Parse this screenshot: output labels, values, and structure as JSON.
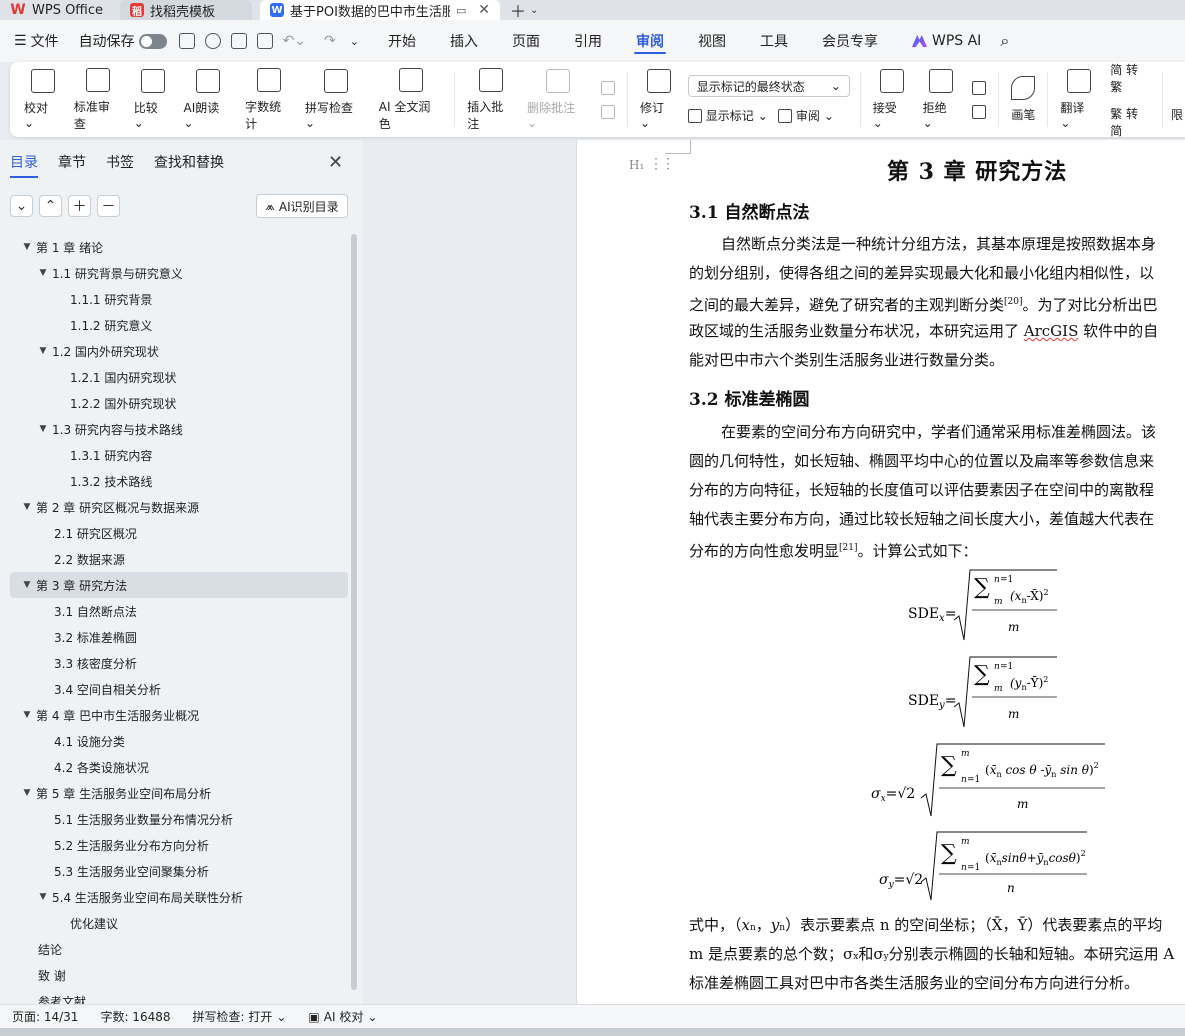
{
  "tabs": [
    {
      "label": "WPS Office",
      "icon": "wps-logo-icon"
    },
    {
      "label": "找稻壳模板",
      "icon": "daoke-icon"
    },
    {
      "label": "基于POI数据的巴中市生活服务",
      "icon": "word-doc-icon",
      "active": true
    }
  ],
  "menubar": {
    "file": "文件",
    "autosave": "自动保存",
    "tabs": [
      "开始",
      "插入",
      "页面",
      "引用",
      "审阅",
      "视图",
      "工具",
      "会员专享"
    ],
    "active_tab": "审阅",
    "wps_ai": "WPS AI"
  },
  "ribbon": {
    "proof": "校对",
    "standard_review": "标准审查",
    "compare": "比较",
    "ai_read": "AI朗读",
    "word_count": "字数统计",
    "spell_check": "拼写检查",
    "ai_polish": "AI 全文润色",
    "insert_comment": "插入批注",
    "delete_comment": "删除批注",
    "display_mode": "显示标记的最终状态",
    "track": "修订",
    "show_marks": "显示标记",
    "review": "审阅",
    "accept": "接受",
    "reject": "拒绝",
    "pen": "画笔",
    "translate": "翻译",
    "to_traditional": "简 转繁",
    "to_simplified": "繁 转简",
    "restrict": "限"
  },
  "leftpanel": {
    "tabs": [
      "目录",
      "章节",
      "书签",
      "查找和替换"
    ],
    "active_tab": "目录",
    "ai_toc": "AI识别目录",
    "toc": [
      {
        "label": "第 1 章  绪论",
        "level": 1,
        "caret": true
      },
      {
        "label": "1.1  研究背景与研究意义",
        "level": 2,
        "caret": true
      },
      {
        "label": "1.1.1  研究背景",
        "level": 3
      },
      {
        "label": "1.1.2  研究意义",
        "level": 3
      },
      {
        "label": "1.2  国内外研究现状",
        "level": 2,
        "caret": true
      },
      {
        "label": "1.2.1  国内研究现状",
        "level": 3
      },
      {
        "label": "1.2.2  国外研究现状",
        "level": 3
      },
      {
        "label": "1.3  研究内容与技术路线",
        "level": 2,
        "caret": true
      },
      {
        "label": "1.3.1  研究内容",
        "level": 3
      },
      {
        "label": "1.3.2  技术路线",
        "level": 3
      },
      {
        "label": "第 2 章  研究区概况与数据来源",
        "level": 1,
        "caret": true
      },
      {
        "label": "2.1  研究区概况",
        "level": 2
      },
      {
        "label": "2.2  数据来源",
        "level": 2
      },
      {
        "label": "第 3 章  研究方法",
        "level": 1,
        "caret": true,
        "selected": true
      },
      {
        "label": "3.1  自然断点法",
        "level": 2
      },
      {
        "label": "3.2  标准差椭圆",
        "level": 2
      },
      {
        "label": "3.3  核密度分析",
        "level": 2
      },
      {
        "label": "3.4  空间自相关分析",
        "level": 2
      },
      {
        "label": "第 4 章  巴中市生活服务业概况",
        "level": 1,
        "caret": true
      },
      {
        "label": "4.1  设施分类",
        "level": 2
      },
      {
        "label": "4.2  各类设施状况",
        "level": 2
      },
      {
        "label": "第 5 章  生活服务业空间布局分析",
        "level": 1,
        "caret": true
      },
      {
        "label": "5.1  生活服务业数量分布情况分析",
        "level": 2
      },
      {
        "label": "5.2  生活服务业分布方向分析",
        "level": 2
      },
      {
        "label": "5.3  生活服务业空间聚集分析",
        "level": 2
      },
      {
        "label": "5.4  生活服务业空间布局关联性分析",
        "level": 2,
        "caret": true
      },
      {
        "label": "优化建议",
        "level": 3
      },
      {
        "label": "结论",
        "level": 1
      },
      {
        "label": "致    谢",
        "level": 1
      },
      {
        "label": "参考文献",
        "level": 1
      }
    ]
  },
  "document": {
    "chapter_title": "第 3 章  研究方法",
    "sec1_title": "3.1  自然断点法",
    "sec1_lines": [
      "自然断点分类法是一种统计分组方法，其基本原理是按照数据本身",
      "的划分组别，使得各组之间的差异实现最大化和最小化组内相似性，以",
      "之间的最大差异，避免了研究者的主观判断分类",
      "政区域的生活服务业数量分布状况，本研究运用了 ",
      "能对巴中市六个类别生活服务业进行数量分类。"
    ],
    "sec1_ref": "[20]",
    "sec1_line3_tail": "。为了对比分析出巴",
    "arcgis": "ArcGIS",
    "sec1_line4_tail": " 软件中的自",
    "sec2_title": "3.2  标准差椭圆",
    "sec2_lines": [
      "在要素的空间分布方向研究中，学者们通常采用标准差椭圆法。该",
      "圆的几何特性，如长短轴、椭圆平均中心的位置以及扁率等参数信息来",
      "分布的方向特征，长短轴的长度值可以评估要素因子在空间中的离散程",
      "轴代表主要分布方向，通过比较长短轴之间长度大小，差值越大代表在",
      "分布的方向性愈发明显"
    ],
    "sec2_ref": "[21]",
    "sec2_tail": "。计算公式如下：",
    "formula1_label": "SDE",
    "formula1_sub": "x",
    "formula2_sub": "y",
    "after_lines": [
      "式中，（",
      "m 是点要素的总个数；σ",
      "标准差椭圆工具对巴中市各类生活服务业的空间分布方向进行分析。"
    ],
    "after1_tail": "）表示要素点 n 的空间坐标；（X̄，Ȳ）代表要素点的平均",
    "after2_tail": "分别表示椭圆的长轴和短轴。本研究运用 A"
  },
  "statusbar": {
    "page": "页面: 14/31",
    "words": "字数: 16488",
    "spell": "拼写检查: 打开",
    "ai_proof": "AI 校对"
  }
}
